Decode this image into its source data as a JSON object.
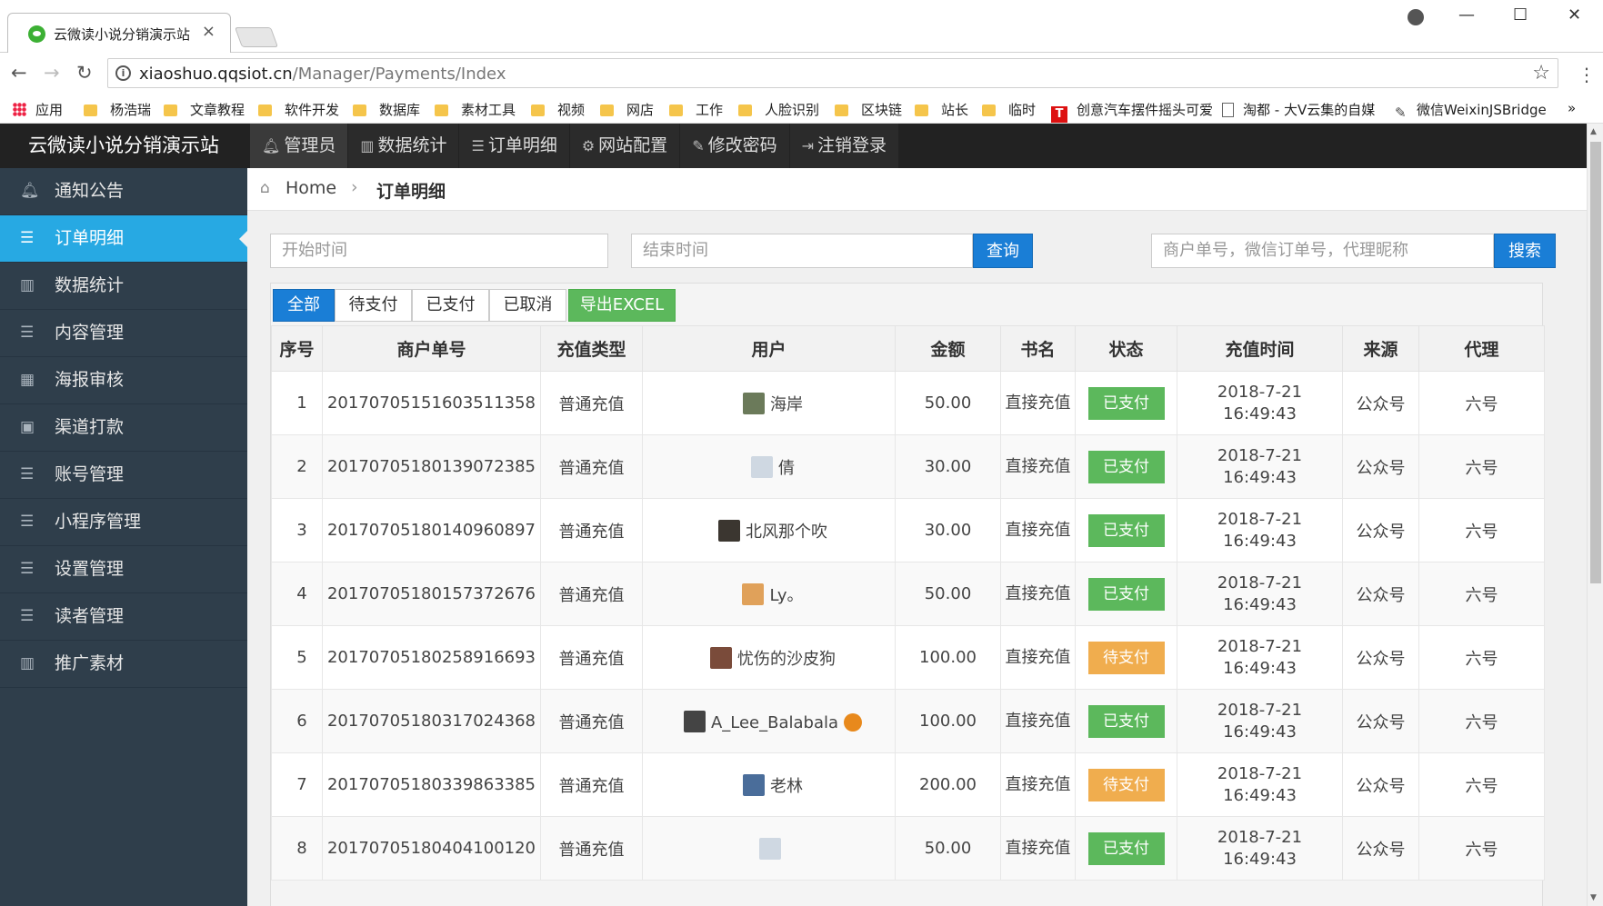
{
  "browser": {
    "tab_title": "云微读小说分销演示站",
    "url_host": "xiaoshuo.qqsiot.cn",
    "url_path": "/Manager/Payments/Index",
    "bookmarks": [
      "应用",
      "杨浩瑞",
      "文章教程",
      "软件开发",
      "数据库",
      "素材工具",
      "视频",
      "网店",
      "工作",
      "人脸识别",
      "区块链",
      "站长",
      "临时",
      "创意汽车摆件摇头可爱",
      "淘都 - 大V云集的自媒",
      "微信WeixinJSBridge"
    ]
  },
  "brand": "云微读小说分销演示站",
  "topnav": [
    "管理员",
    "数据统计",
    "订单明细",
    "网站配置",
    "修改密码",
    "注销登录"
  ],
  "sidebar": [
    "通知公告",
    "订单明细",
    "数据统计",
    "内容管理",
    "海报审核",
    "渠道打款",
    "账号管理",
    "小程序管理",
    "设置管理",
    "读者管理",
    "推广素材"
  ],
  "breadcrumb": {
    "home": "Home",
    "current": "订单明细"
  },
  "filters": {
    "start_placeholder": "开始时间",
    "end_placeholder": "结束时间",
    "query_btn": "查询",
    "search_placeholder": "商户单号，微信订单号，代理昵称",
    "search_btn": "搜索"
  },
  "tabs": [
    "全部",
    "待支付",
    "已支付",
    "已取消",
    "导出EXCEL"
  ],
  "columns": [
    "序号",
    "商户单号",
    "充值类型",
    "用户",
    "金额",
    "书名",
    "状态",
    "充值时间",
    "来源",
    "代理"
  ],
  "rows": [
    {
      "no": "1",
      "order": "20170705151603511358",
      "type": "普通充值",
      "user": "海岸",
      "amount": "50.00",
      "book": "直接充值",
      "status": "已支付",
      "date": "2018-7-21",
      "time": "16:49:43",
      "source": "公众号",
      "agent": "六号"
    },
    {
      "no": "2",
      "order": "20170705180139072385",
      "type": "普通充值",
      "user": "倩",
      "amount": "30.00",
      "book": "直接充值",
      "status": "已支付",
      "date": "2018-7-21",
      "time": "16:49:43",
      "source": "公众号",
      "agent": "六号"
    },
    {
      "no": "3",
      "order": "20170705180140960897",
      "type": "普通充值",
      "user": "北风那个吹",
      "amount": "30.00",
      "book": "直接充值",
      "status": "已支付",
      "date": "2018-7-21",
      "time": "16:49:43",
      "source": "公众号",
      "agent": "六号"
    },
    {
      "no": "4",
      "order": "20170705180157372676",
      "type": "普通充值",
      "user": "Ly。",
      "amount": "50.00",
      "book": "直接充值",
      "status": "已支付",
      "date": "2018-7-21",
      "time": "16:49:43",
      "source": "公众号",
      "agent": "六号"
    },
    {
      "no": "5",
      "order": "20170705180258916693",
      "type": "普通充值",
      "user": "忧伤的沙皮狗",
      "amount": "100.00",
      "book": "直接充值",
      "status": "待支付",
      "date": "2018-7-21",
      "time": "16:49:43",
      "source": "公众号",
      "agent": "六号"
    },
    {
      "no": "6",
      "order": "20170705180317024368",
      "type": "普通充值",
      "user": "A_Lee_Balabala",
      "amount": "100.00",
      "book": "直接充值",
      "status": "已支付",
      "date": "2018-7-21",
      "time": "16:49:43",
      "source": "公众号",
      "agent": "六号"
    },
    {
      "no": "7",
      "order": "20170705180339863385",
      "type": "普通充值",
      "user": "老林",
      "amount": "200.00",
      "book": "直接充值",
      "status": "待支付",
      "date": "2018-7-21",
      "time": "16:49:43",
      "source": "公众号",
      "agent": "六号"
    },
    {
      "no": "8",
      "order": "20170705180404100120",
      "type": "普通充值",
      "user": "",
      "amount": "50.00",
      "book": "直接充值",
      "status": "已支付",
      "date": "2018-7-21",
      "time": "16:49:43",
      "source": "公众号",
      "agent": "六号"
    }
  ],
  "colors": {
    "accent": "#27a9e3",
    "paid": "#5cb85c",
    "pending": "#f0ad4e",
    "primary": "#1a7ed6"
  }
}
